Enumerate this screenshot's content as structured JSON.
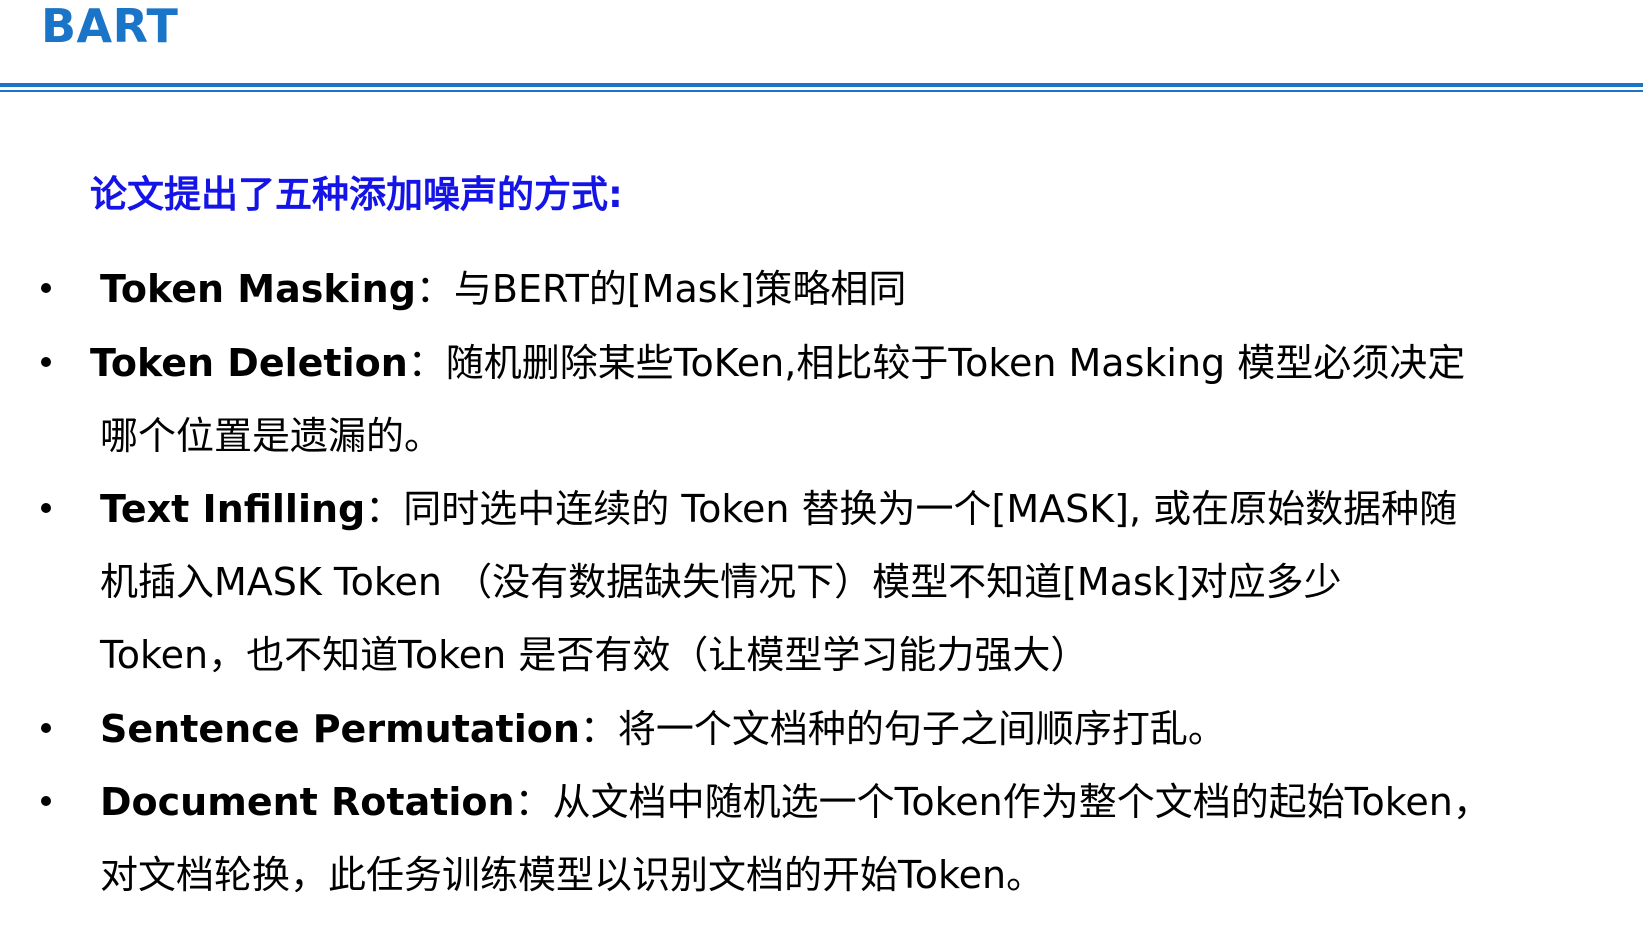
{
  "title": "BART",
  "subtitle": "论文提出了五种添加噪声的方式:",
  "items": [
    {
      "term": "Token Masking",
      "lines": [
        "：与BERT的[Mask]策略相同"
      ]
    },
    {
      "term": "Token Deletion",
      "lines": [
        "：随机删除某些ToKen,相比较于Token Masking 模型必须决定",
        "哪个位置是遗漏的。"
      ]
    },
    {
      "term": "Text Infilling",
      "lines": [
        "：同时选中连续的 Token 替换为一个[MASK], 或在原始数据种随",
        "机插入MASK Token （没有数据缺失情况下）模型不知道[Mask]对应多少",
        "Token，也不知道Token 是否有效（让模型学习能力强大）"
      ]
    },
    {
      "term": "Sentence Permutation",
      "lines": [
        "：将一个文档种的句子之间顺序打乱。"
      ]
    },
    {
      "term": "Document Rotation",
      "lines": [
        "：从文档中随机选一个Token作为整个文档的起始Token，",
        "对文档轮换，此任务训练模型以识别文档的开始Token。"
      ]
    }
  ],
  "colors": {
    "title": "#1a74c7",
    "subtitle": "#1414e6",
    "rule": "#1a74c7",
    "text": "#000000"
  }
}
